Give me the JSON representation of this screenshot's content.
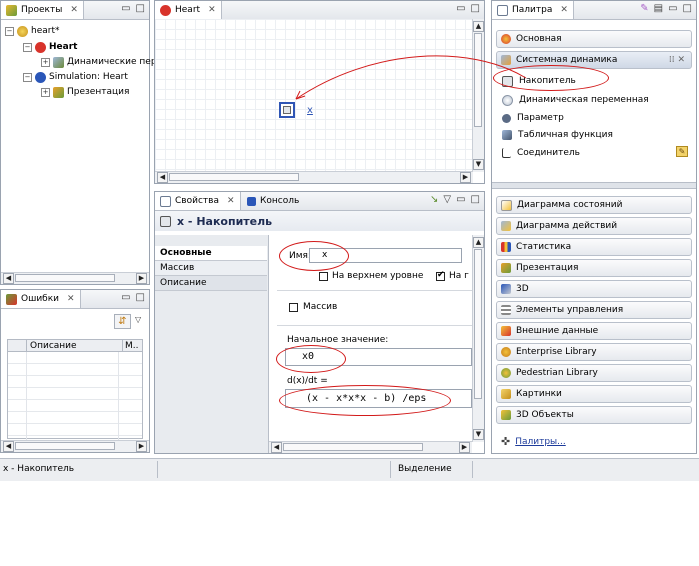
{
  "projects_panel": {
    "tab_label": "Проекты",
    "tree": [
      {
        "label": "heart*",
        "bold": false
      },
      {
        "label": "Heart",
        "bold": true
      },
      {
        "label": "Динамические пере",
        "bold": false
      },
      {
        "label": "Simulation: Heart",
        "bold": false
      },
      {
        "label": "Презентация",
        "bold": false
      }
    ]
  },
  "errors_panel": {
    "tab_label": "Ошибки",
    "col_description": "Описание",
    "col_m": "М.."
  },
  "editor": {
    "tab_label": "Heart",
    "element_label": "x"
  },
  "properties": {
    "tab_label": "Свойства",
    "console_tab_label": "Консоль",
    "title": "x - Накопитель",
    "side_tabs": [
      "Основные",
      "Массив",
      "Описание"
    ],
    "name_label": "Имя:",
    "name_value": "x",
    "top_level_label": "На верхнем уровне",
    "truncated_label": "На г",
    "array_label": "Массив",
    "initial_label": "Начальное значение:",
    "initial_value": "x0",
    "derivative_label": "d(x)/dt =",
    "derivative_value": "(x - x*x*x - b) /eps"
  },
  "palette": {
    "tab_label": "Палитра",
    "sections_top": [
      "Основная",
      "Системная динамика"
    ],
    "items": [
      "Накопитель",
      "Динамическая переменная",
      "Параметр",
      "Табличная функция",
      "Соединитель"
    ],
    "sections_bottom": [
      "Диаграмма состояний",
      "Диаграмма действий",
      "Статистика",
      "Презентация",
      "3D",
      "Элементы управления",
      "Внешние данные",
      "Enterprise Library",
      "Pedestrian Library",
      "Картинки",
      "3D Объекты"
    ],
    "more_link": "Палитры..."
  },
  "status": {
    "left": "x - Накопитель",
    "mode": "Выделение"
  },
  "colors": {
    "annotation_red": "#d21a1a",
    "tab_border": "#9aa3b0",
    "selection_blue": "#2f55b5"
  }
}
